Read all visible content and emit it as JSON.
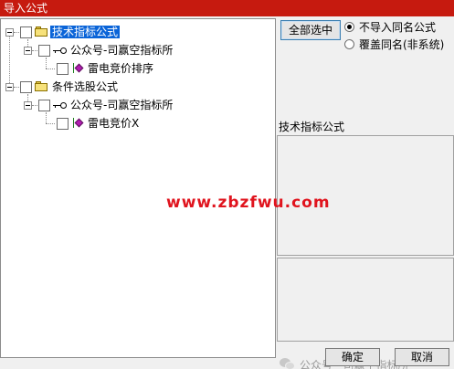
{
  "window": {
    "title": "导入公式"
  },
  "tree": {
    "nodes": [
      {
        "label": "技术指标公式",
        "selected": true
      },
      {
        "label": "公众号-司赢空指标所"
      },
      {
        "label": "雷电竞价排序"
      },
      {
        "label": "条件选股公式"
      },
      {
        "label": "公众号-司赢空指标所"
      },
      {
        "label": "雷电竞价X"
      }
    ]
  },
  "options": {
    "select_all_label": "全部选中",
    "radio_no_import": "不导入同名公式",
    "radio_overwrite": "覆盖同名(非系统)",
    "selected_radio": "no_import"
  },
  "detail": {
    "category_label": "技术指标公式"
  },
  "buttons": {
    "ok": "确定",
    "cancel": "取消"
  },
  "watermark": {
    "site": "www.zbzfwu.com",
    "footer": "公众号 · 司赢空指标所"
  },
  "colors": {
    "titlebar": "#c61a0f",
    "selection": "#0a64d8",
    "watermark": "#e0141e"
  }
}
